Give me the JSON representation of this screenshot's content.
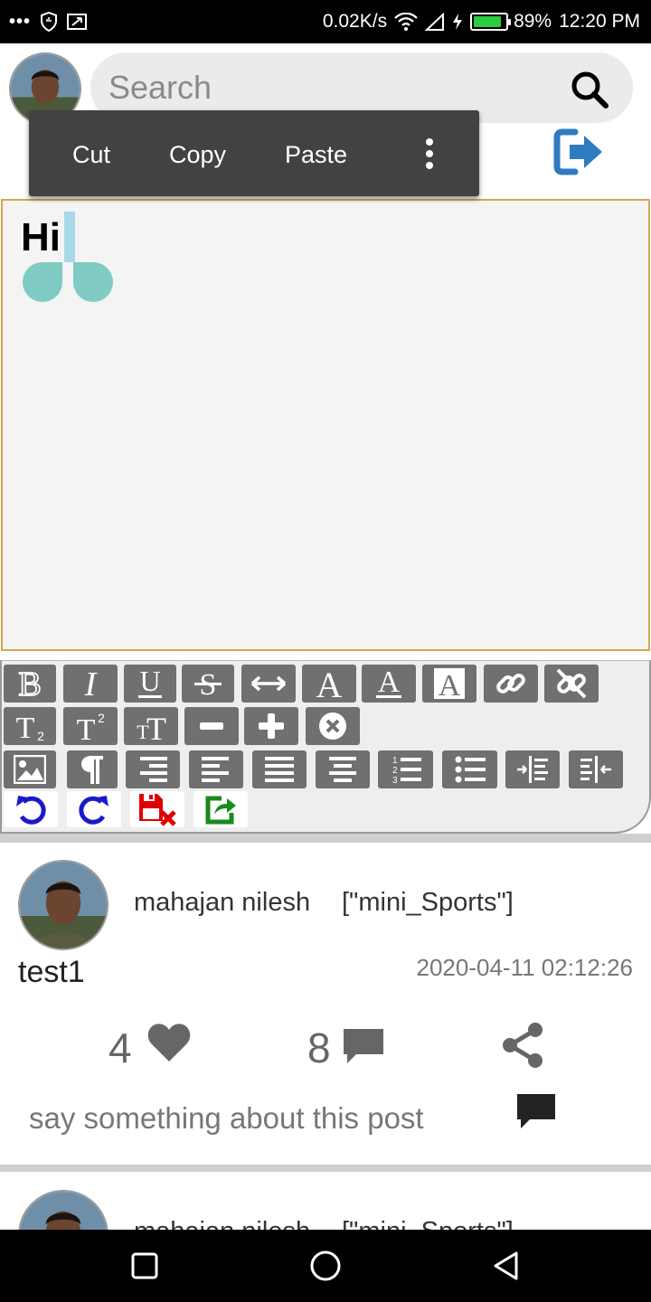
{
  "status_bar": {
    "dots": "•••",
    "net_speed": "0.02K/s",
    "battery_percent": "89%",
    "battery_level": 0.89,
    "time": "12:20 PM"
  },
  "header": {
    "search_placeholder": "Search"
  },
  "context_menu": {
    "cut": "Cut",
    "copy": "Copy",
    "paste": "Paste"
  },
  "editor": {
    "text": "Hi"
  },
  "toolbar": {
    "row1": [
      "bold",
      "italic",
      "underline",
      "strikethrough",
      "text-width",
      "font-color",
      "font-underline-color",
      "font-background"
    ],
    "extra": [
      "link",
      "unlink"
    ],
    "row2": [
      "subscript",
      "superscript",
      "text-size",
      "decrease",
      "increase",
      "remove-format"
    ],
    "row3": [
      "insert-image",
      "paragraph",
      "align-right",
      "align-left",
      "justify",
      "align-center",
      "ordered-list",
      "unordered-list",
      "indent",
      "outdent"
    ],
    "row4": [
      "undo",
      "redo",
      "delete",
      "share"
    ]
  },
  "post": {
    "author": "mahajan nilesh",
    "category": "[\"mini_Sports\"]",
    "title": "test1",
    "timestamp": "2020-04-11 02:12:26",
    "like_count": "4",
    "comment_count": "8",
    "comment_placeholder": "say something about this post"
  },
  "next_post": {
    "author": "mahajan nilesh",
    "category": "[\"mini_Sports\"]"
  },
  "colors": {
    "accent_blue": "#2f7bbf",
    "editor_border": "#d4a84f",
    "selection_handle": "#80cbc4",
    "toolbar_button": "#707070",
    "delete_red": "#e00000",
    "share_green": "#1a8a1a",
    "undo_blue": "#1a1acc"
  }
}
